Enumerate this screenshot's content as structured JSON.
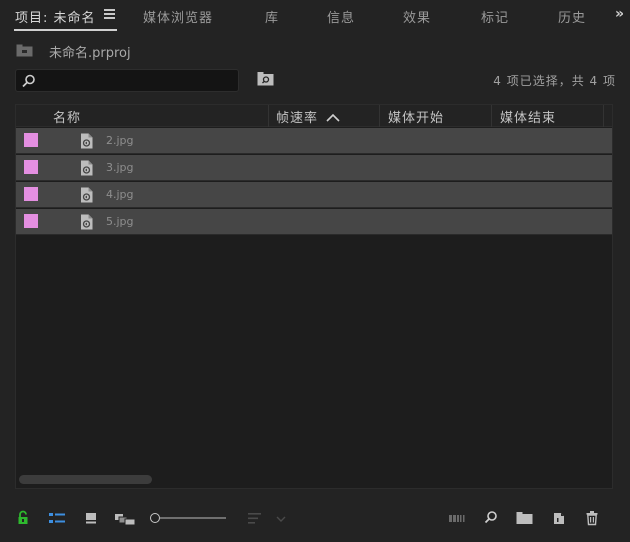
{
  "tabs": [
    {
      "label": "项目: 未命名",
      "active": true
    },
    {
      "label": "媒体浏览器",
      "active": false
    },
    {
      "label": "库",
      "active": false
    },
    {
      "label": "信息",
      "active": false
    },
    {
      "label": "效果",
      "active": false
    },
    {
      "label": "标记",
      "active": false
    },
    {
      "label": "历史",
      "active": false
    }
  ],
  "overflow": "»",
  "project": {
    "file_name": "未命名.prproj"
  },
  "search": {
    "value": "",
    "placeholder": ""
  },
  "selection_status": "4 项已选择，共 4 项",
  "columns": {
    "name": "名称",
    "frame_rate": "帧速率",
    "media_start": "媒体开始",
    "media_end": "媒体结束"
  },
  "items": [
    {
      "name": "2.jpg",
      "label_color": "#e48fe1"
    },
    {
      "name": "3.jpg",
      "label_color": "#e48fe1"
    },
    {
      "name": "4.jpg",
      "label_color": "#e48fe1"
    },
    {
      "name": "5.jpg",
      "label_color": "#e48fe1"
    }
  ],
  "colors": {
    "accent_lock": "#2eb82e",
    "accent_list": "#3d8fe0",
    "selected_row": "#464646"
  }
}
